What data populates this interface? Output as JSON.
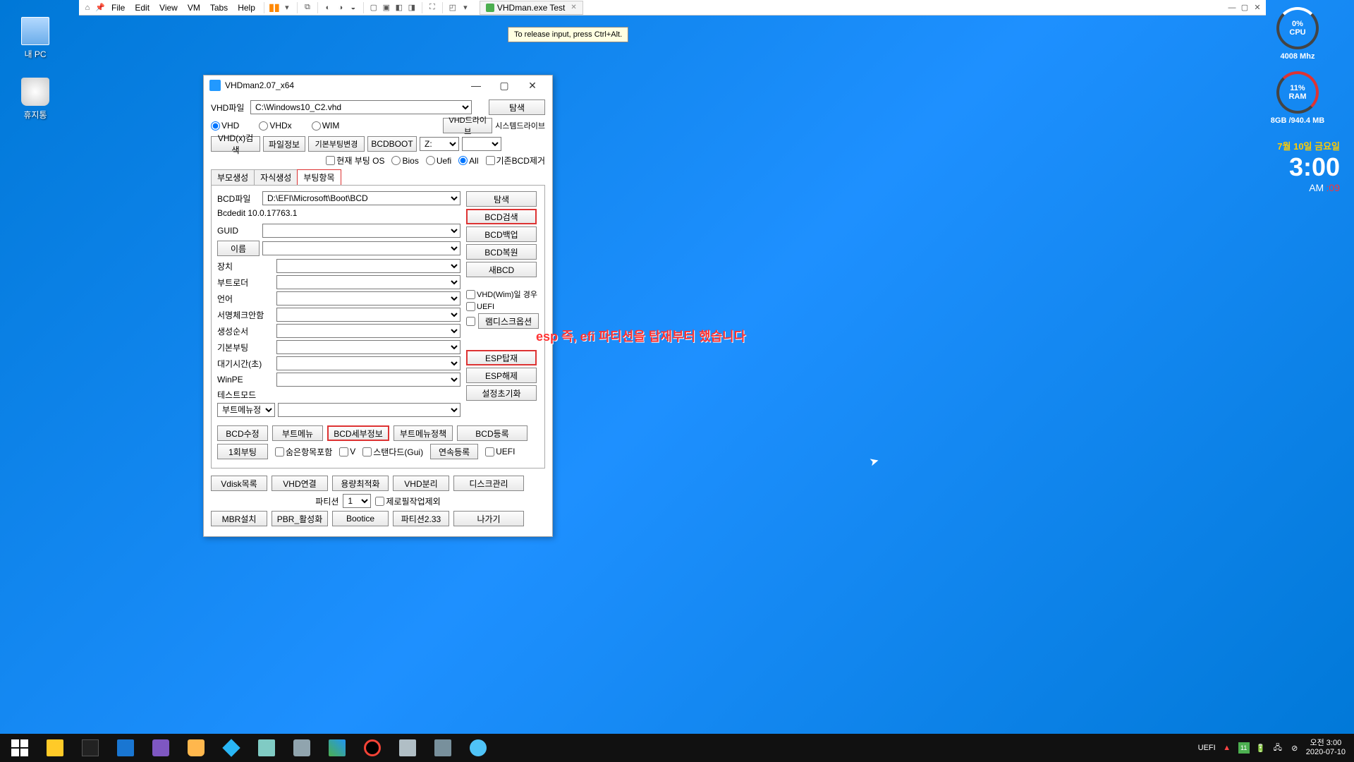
{
  "vm_menu": {
    "items": [
      "File",
      "Edit",
      "View",
      "VM",
      "Tabs",
      "Help"
    ],
    "tab_title": "VHDman.exe Test",
    "tooltip": "To release input, press Ctrl+Alt."
  },
  "desktop_icons": {
    "pc": "내 PC",
    "trash": "휴지통"
  },
  "gauges": {
    "cpu_pct": "0%",
    "cpu_lbl": "CPU",
    "cpu_sub": "4008 Mhz",
    "ram_pct": "11%",
    "ram_lbl": "RAM",
    "ram_sub": "8GB /940.4 MB",
    "date": "7월 10일 금요일",
    "time": "3:00",
    "ampm": "AM",
    "sec": ":09"
  },
  "annotation": "esp 즉, efi 파티션을 탑재부터 했습니다",
  "app": {
    "title": "VHDman2.07_x64",
    "vhd_file_lbl": "VHD파일",
    "vhd_file": "C:\\Windows10_C2.vhd",
    "r_vhd": "VHD",
    "r_vhdx": "VHDx",
    "r_wim": "WIM",
    "btn_search": "탐색",
    "btn_vhdx_search": "VHD(x)검색",
    "btn_fileinfo": "파일정보",
    "btn_bootchange": "기본부팅변경",
    "btn_bcdboot": "BCDBOOT",
    "lbl_vhddrive": "VHD드라이브",
    "lbl_sysdrive": "시스템드라이브",
    "vhddrive_val": "Z:",
    "chk_current_os": "현재 부팅 OS",
    "r_bios": "Bios",
    "r_uefi": "Uefi",
    "r_all": "All",
    "chk_bcd_remove": "기존BCD제거",
    "tabs": [
      "부모생성",
      "자식생성",
      "부팅항목"
    ],
    "bcdfile_lbl": "BCD파일",
    "bcdfile": "D:\\EFI\\Microsoft\\Boot\\BCD",
    "bcdedit_ver": "Bcdedit 10.0.17763.1",
    "rc_search": "탐색",
    "rc_bcd_search": "BCD검색",
    "rc_bcd_backup": "BCD백업",
    "rc_bcd_restore": "BCD복원",
    "rc_new_bcd": "새BCD",
    "guid_lbl": "GUID",
    "btn_name": "이름",
    "fields": {
      "device": "장치",
      "bootloader": "부트로더",
      "lang": "언어",
      "nosigcheck": "서명체크안함",
      "createorder": "생성순서",
      "defaultboot": "기본부팅",
      "timeout": "대기시간(초)",
      "winpe": "WinPE",
      "testmode": "테스트모드",
      "bootmenu": "부트메뉴정책"
    },
    "chk_vhdwim": "VHD(Wim)일 경우",
    "chk_uefi2": "UEFI",
    "btn_ramdisk": "램디스크옵션",
    "btn_esp_mount": "ESP탑재",
    "btn_esp_unmount": "ESP해제",
    "btn_reset": "설정초기화",
    "btn_bcd_edit": "BCD수정",
    "btn_bootmenu": "부트메뉴",
    "btn_bcd_detail": "BCD세부정보",
    "btn_bootmenu_policy": "부트메뉴정책",
    "btn_bcd_register": "BCD등록",
    "btn_oneboot": "1회부팅",
    "chk_hidden": "숨은항목포함",
    "chk_v": "V",
    "chk_standard": "스탠다드(Gui)",
    "btn_cont_reg": "연속등록",
    "chk_uefi3": "UEFI",
    "btn_vdisk": "Vdisk목록",
    "btn_vhd_connect": "VHD연결",
    "btn_capacity": "용량최적화",
    "btn_vhd_split": "VHD분리",
    "btn_disk_mgmt": "디스크관리",
    "lbl_partition": "파티션",
    "part_val": "1",
    "chk_zerofill": "제로필작업제외",
    "btn_mbr": "MBR설치",
    "btn_pbr": "PBR_활성화",
    "btn_bootice": "Bootice",
    "btn_partition233": "파티션2.33",
    "btn_exit": "나가기"
  },
  "taskbar": {
    "uefi": "UEFI",
    "badge": "11",
    "clock_time": "오전 3:00",
    "clock_date": "2020-07-10"
  }
}
